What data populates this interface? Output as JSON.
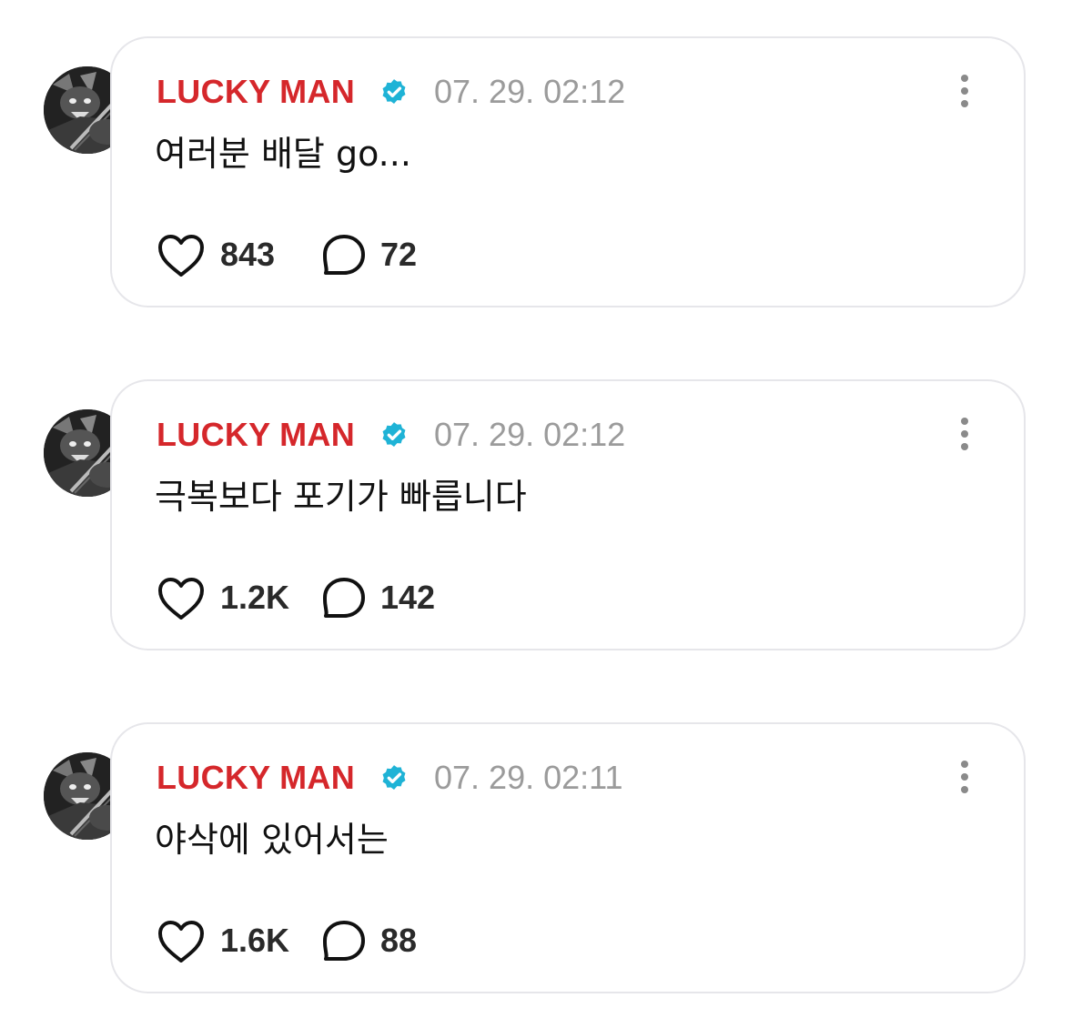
{
  "colors": {
    "author": "#d5272b",
    "verified_badge": "#1fb3d6",
    "timestamp": "#9b9b9b",
    "card_border": "#e6e6ea"
  },
  "icons": {
    "verified": "verified-badge-icon",
    "more": "more-vertical-icon",
    "like": "heart-icon",
    "reply": "speech-bubble-icon"
  },
  "posts": [
    {
      "author": "LUCKY MAN",
      "timestamp": "07. 29. 02:12",
      "text": "여러분 배달 go...",
      "likes": "843",
      "replies": "72"
    },
    {
      "author": "LUCKY MAN",
      "timestamp": "07. 29. 02:12",
      "text": "극복보다 포기가 빠릅니다",
      "likes": "1.2K",
      "replies": "142"
    },
    {
      "author": "LUCKY MAN",
      "timestamp": "07. 29. 02:11",
      "text": "야삭에 있어서는",
      "likes": "1.6K",
      "replies": "88"
    }
  ]
}
